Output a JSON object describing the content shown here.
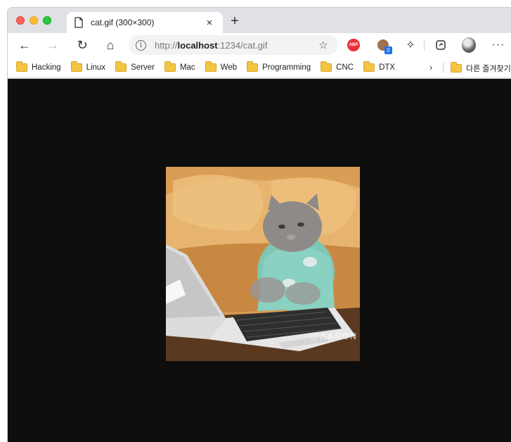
{
  "window": {
    "tab": {
      "title": "cat.gif (300×300)",
      "close_glyph": "×",
      "icon": "page-icon"
    },
    "new_tab_glyph": "+"
  },
  "toolbar": {
    "back_glyph": "←",
    "forward_glyph": "→",
    "reload_glyph": "↻",
    "home_glyph": "⌂",
    "url": {
      "scheme": "http://",
      "host": "localhost",
      "rest": ":1234/cat.gif"
    },
    "favorite_glyph": "☆",
    "abp_label": "ABP",
    "cookie_badge": "0",
    "extensions_glyph": "✧",
    "more_glyph": "···"
  },
  "bookmarks": {
    "items": [
      {
        "label": "Hacking"
      },
      {
        "label": "Linux"
      },
      {
        "label": "Server"
      },
      {
        "label": "Mac"
      },
      {
        "label": "Web"
      },
      {
        "label": "Programming"
      },
      {
        "label": "CNC"
      },
      {
        "label": "DTX"
      }
    ],
    "overflow_glyph": "›",
    "other_label": "다른 즐겨찾기"
  },
  "content": {
    "image_watermark": "@AARON",
    "background": "#0e0e0e"
  },
  "colors": {
    "tab_strip": "#dfe1e5",
    "close": "#ff5f57",
    "minimize": "#febc2e",
    "maximize": "#28c840",
    "folder": "#f5c542",
    "abp": "#e8313c"
  }
}
